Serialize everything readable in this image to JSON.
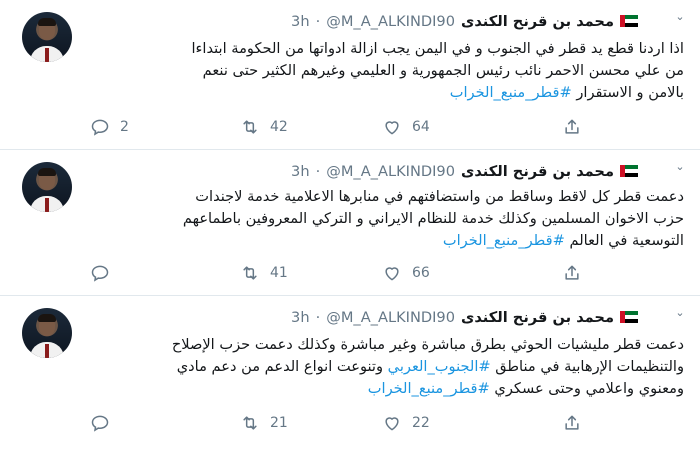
{
  "tweets": [
    {
      "name": "محمد بن قرنح الكندى",
      "handle": "@M_A_ALKINDI90",
      "separator": "·",
      "time": "3h",
      "text_lines": [
        "اذا اردنا قطع يد قطر في الجنوب و في اليمن يجب ازالة ادواتها من الحكومة ابتداءا",
        "من علي محسن الاحمر نائب رئيس الجمهورية و العليمي وغيرهم الكثير حتى ننعم",
        "بالامن و الاستقرار"
      ],
      "hashtag": "#قطر_منبع_الخراب",
      "replies": "2",
      "retweets": "42",
      "likes": "64"
    },
    {
      "name": "محمد بن قرنح الكندى",
      "handle": "@M_A_ALKINDI90",
      "separator": "·",
      "time": "3h",
      "text_lines": [
        "دعمت قطر كل لاقط وساقط من واستضافتهم في منابرها الاعلامية خدمة لاجندات",
        "حزب الاخوان المسلمين وكذلك خدمة للنظام الايراني و التركي المعروفين باطماعهم",
        "التوسعية في العالم"
      ],
      "hashtag": "#قطر_منبع_الخراب",
      "replies": "",
      "retweets": "41",
      "likes": "66"
    },
    {
      "name": "محمد بن قرنح الكندى",
      "handle": "@M_A_ALKINDI90",
      "separator": "·",
      "time": "3h",
      "text_lines": [
        "دعمت قطر مليشيات الحوثي بطرق مباشرة وغير مباشرة وكذلك دعمت حزب الإصلاح",
        "والتنظيمات الإرهابية في مناطق",
        "ومعنوي واعلامي وحتى عسكري"
      ],
      "inline_hashtag": "#الجنوب_العربي",
      "line2_tail": "وتنوعت انواع الدعم من دعم مادي",
      "hashtag": "#قطر_منبع_الخراب",
      "replies": "",
      "retweets": "21",
      "likes": "22"
    }
  ],
  "colors": {
    "text": "#14171a",
    "muted": "#657786",
    "hashtag": "#1b95e0",
    "divider": "#e1e8ed"
  },
  "icons": [
    "reply-icon",
    "retweet-icon",
    "like-icon",
    "share-icon",
    "caret-down-icon",
    "uae-flag-icon"
  ]
}
